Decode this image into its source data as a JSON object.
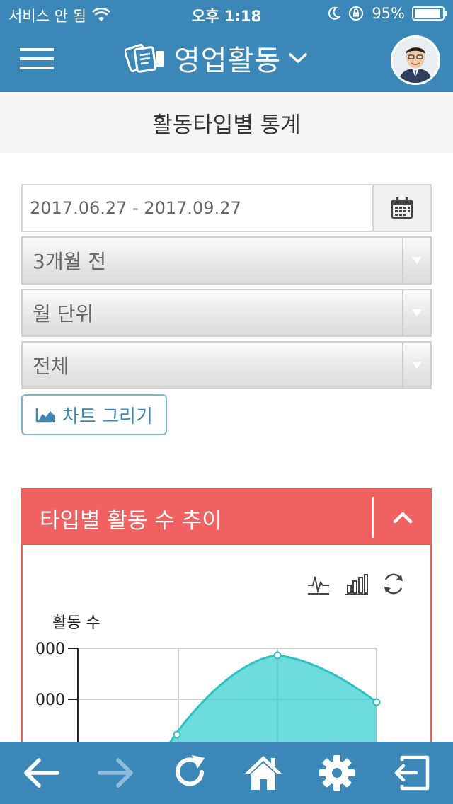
{
  "status_bar": {
    "carrier": "서비스 안 됨",
    "time": "오후 1:18",
    "battery": "95%",
    "battery_level": 0.95
  },
  "header": {
    "title": "영업활동",
    "menu_icon": "hamburger-icon",
    "title_icon": "business-cards-icon",
    "dropdown_icon": "chevron-down-icon",
    "avatar": "user-avatar"
  },
  "page": {
    "title": "활동타입별 통계"
  },
  "form": {
    "date_range": "2017.06.27 - 2017.09.27",
    "calendar_icon": "calendar-icon",
    "period_select": "3개월 전",
    "unit_select": "월 단위",
    "type_select": "전체",
    "chart_button": "차트 그리기"
  },
  "panel": {
    "title": "타입별 활동 수 추이",
    "collapse_icon": "chevron-up-icon",
    "tools": [
      "line-chart-icon",
      "bar-chart-icon",
      "refresh-icon"
    ]
  },
  "chart_data": {
    "type": "area",
    "ylabel": "활동 수",
    "ytick_labels": [
      "000",
      "000"
    ],
    "color": "#3dcfd0",
    "grid": true
  },
  "bottom_nav": {
    "items": [
      "back-arrow-icon",
      "forward-arrow-icon",
      "reload-icon",
      "home-icon",
      "settings-gear-icon",
      "logout-icon"
    ]
  },
  "colors": {
    "header": "#3b87b8",
    "panel": "#f06161",
    "chart_fill": "#3dcfd0"
  }
}
